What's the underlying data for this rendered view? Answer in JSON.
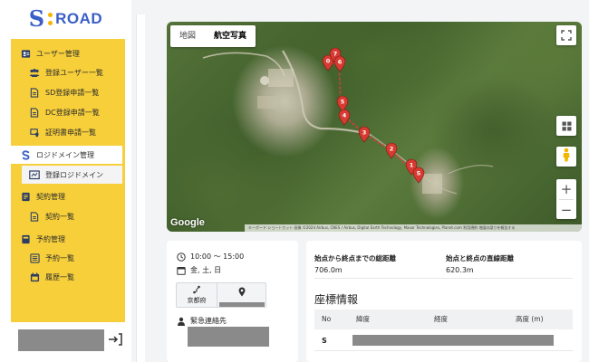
{
  "brand": {
    "logo_s": "S",
    "logo_word": "ROAD",
    "colors": {
      "accent_blue": "#3a5fc6",
      "menu_yellow": "#f7cf3a",
      "pin_red": "#d73a31",
      "route_red": "#e53935"
    }
  },
  "sidebar": {
    "sections": [
      {
        "label": "ユーザー管理",
        "icon": "id-card-icon"
      },
      {
        "label": "ロジドメイン管理",
        "icon": "s-logo-icon"
      },
      {
        "label": "契約管理",
        "icon": "handshake-icon"
      },
      {
        "label": "予約管理",
        "icon": "calendar-book-icon"
      }
    ],
    "items": [
      {
        "label": "登録ユーザー一覧",
        "icon": "users-icon"
      },
      {
        "label": "SD登録申請一覧",
        "icon": "document-icon"
      },
      {
        "label": "DC登録申請一覧",
        "icon": "document-icon"
      },
      {
        "label": "証明書申請一覧",
        "icon": "certificate-icon"
      },
      {
        "label": "登録ロジドメイン",
        "icon": "map-icon"
      },
      {
        "label": "契約一覧",
        "icon": "document-icon"
      },
      {
        "label": "予約一覧",
        "icon": "list-icon"
      },
      {
        "label": "履歴一覧",
        "icon": "calendar-icon"
      }
    ],
    "logout_icon": "logout-icon"
  },
  "map": {
    "tabs": [
      {
        "label": "地図",
        "selected": false
      },
      {
        "label": "航空写真",
        "selected": true
      }
    ],
    "zoom_in": "+",
    "zoom_out": "−",
    "google_label": "Google",
    "attribution": "キーボード ショートカット   画像 ©2024 Airbus, CNES / Airbus, Digital Earth Technology, Maxar Technologies, Planet.com   利用規約   地図の誤りを報告する",
    "waypoints": [
      "0",
      "7",
      "6",
      "5",
      "4",
      "3",
      "2",
      "1",
      "S"
    ]
  },
  "details": {
    "time": "10:00 ～ 15:00",
    "days": "金, 土, 日",
    "prefecture": "京都府",
    "emergency_label": "緊急連絡先"
  },
  "stats": {
    "total_label": "始点から終点までの総距離",
    "total_value": "706.0m",
    "straight_label": "始点と終点の直線距離",
    "straight_value": "620.3m"
  },
  "coordinates": {
    "title": "座標情報",
    "headers": [
      "No",
      "緯度",
      "経度",
      "高度 (m)"
    ],
    "rows": [
      {
        "no": "S"
      }
    ]
  }
}
